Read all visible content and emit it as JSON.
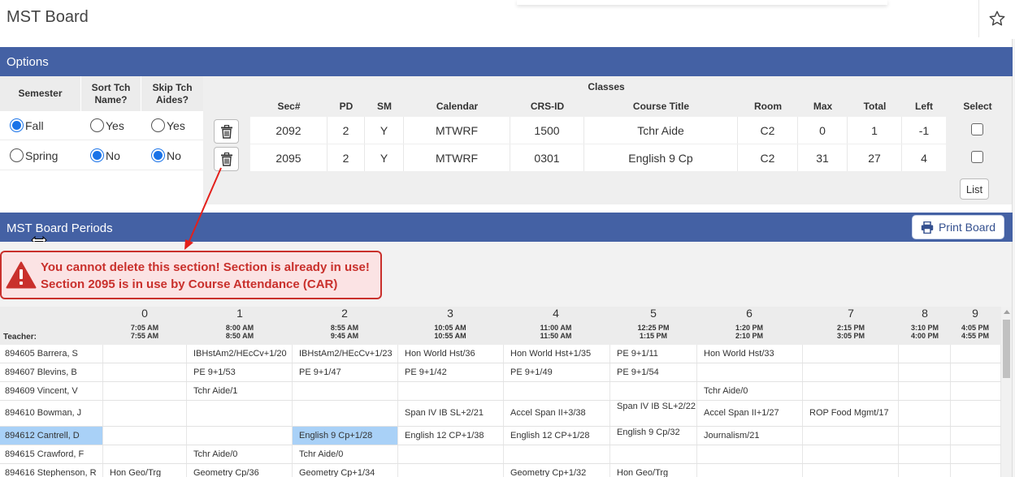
{
  "page": {
    "title": "MST Board"
  },
  "options": {
    "section_title": "Options",
    "headers": {
      "semester": "Semester",
      "sort_tch_name": "Sort Tch Name?",
      "skip_tch_aides": "Skip Tch Aides?"
    },
    "semester_options": [
      {
        "label": "Fall",
        "selected": true
      },
      {
        "label": "Spring",
        "selected": false
      }
    ],
    "sort_options": [
      {
        "label": "Yes",
        "selected": false
      },
      {
        "label": "No",
        "selected": true
      }
    ],
    "skip_options": [
      {
        "label": "Yes",
        "selected": false
      },
      {
        "label": "No",
        "selected": true
      }
    ]
  },
  "classes": {
    "title": "Classes",
    "columns": [
      "Sec#",
      "PD",
      "SM",
      "Calendar",
      "CRS-ID",
      "Course Title",
      "Room",
      "Max",
      "Total",
      "Left",
      "Select"
    ],
    "rows": [
      [
        "2092",
        "2",
        "Y",
        "MTWRF",
        "1500",
        "Tchr Aide",
        "C2",
        "0",
        "1",
        "-1"
      ],
      [
        "2095",
        "2",
        "Y",
        "MTWRF",
        "0301",
        "English 9 Cp",
        "C2",
        "31",
        "27",
        "4"
      ]
    ],
    "list_button": "List"
  },
  "board": {
    "section_title": "MST Board Periods",
    "print_button": "Print Board",
    "teacher_label": "Teacher:",
    "periods": [
      {
        "num": "0",
        "start": "7:05 AM",
        "end": "7:55 AM"
      },
      {
        "num": "1",
        "start": "8:00 AM",
        "end": "8:50 AM"
      },
      {
        "num": "2",
        "start": "8:55 AM",
        "end": "9:45 AM"
      },
      {
        "num": "3",
        "start": "10:05 AM",
        "end": "10:55 AM"
      },
      {
        "num": "4",
        "start": "11:00 AM",
        "end": "11:50 AM"
      },
      {
        "num": "5",
        "start": "12:25 PM",
        "end": "1:15 PM"
      },
      {
        "num": "6",
        "start": "1:20 PM",
        "end": "2:10 PM"
      },
      {
        "num": "7",
        "start": "2:15 PM",
        "end": "3:05 PM"
      },
      {
        "num": "8",
        "start": "3:10 PM",
        "end": "4:00 PM"
      },
      {
        "num": "9",
        "start": "4:05 PM",
        "end": "4:55 PM"
      }
    ],
    "rows": [
      {
        "teacher": "894605 Barrera, S",
        "cells": [
          "",
          "IBHstAm2/HEcCv+1/20",
          "IBHstAm2/HEcCv+1/23",
          "Hon World Hst/36",
          "Hon World Hst+1/35",
          "PE 9+1/11",
          "Hon World Hst/33",
          "",
          "",
          ""
        ]
      },
      {
        "teacher": "894607 Blevins, B",
        "cells": [
          "",
          "PE 9+1/53",
          "PE 9+1/47",
          "PE 9+1/42",
          "PE 9+1/49",
          "PE 9+1/54",
          "",
          "",
          "",
          ""
        ]
      },
      {
        "teacher": "894609 Vincent, V",
        "cells": [
          "",
          "Tchr Aide/1",
          "",
          "",
          "",
          "",
          "Tchr Aide/0",
          "",
          "",
          ""
        ]
      },
      {
        "teacher": "894610 Bowman, J",
        "cells": [
          "",
          "",
          "",
          "Span IV IB SL+2/21",
          "Accel Span II+3/38",
          "Span IV IB SL+2/22",
          "Accel Span II+1/27",
          "ROP Food Mgmt/17",
          "",
          ""
        ]
      },
      {
        "teacher": "894612 Cantrell, D",
        "cells": [
          "",
          "",
          "English 9 Cp+1/28",
          "English 12 CP+1/38",
          "English 12 CP+1/28",
          "English 9 Cp/32",
          "Journalism/21",
          "",
          "",
          ""
        ]
      },
      {
        "teacher": "894615 Crawford, F",
        "cells": [
          "",
          "Tchr Aide/0",
          "Tchr Aide/0",
          "",
          "",
          "",
          "",
          "",
          "",
          ""
        ]
      },
      {
        "teacher": "894616 Stephenson, R",
        "cells": [
          "Hon Geo/Trg",
          "Geometry Cp/36",
          "Geometry Cp+1/34",
          "",
          "Geometry Cp+1/32",
          "Hon Geo/Trg",
          "",
          "",
          "",
          ""
        ]
      }
    ]
  },
  "alert": {
    "line1": "You cannot delete this section! Section is already in use!",
    "line2": "Section 2095 is in use by Course Attendance (CAR)"
  },
  "colors": {
    "header_blue": "#4461a4",
    "alert_red": "#c9302c",
    "radio_blue": "#1a73e8",
    "highlight": "#a9d1f7"
  },
  "icons": [
    "star-icon",
    "trash-icon",
    "printer-icon",
    "warning-icon",
    "resize-cursor-icon"
  ]
}
